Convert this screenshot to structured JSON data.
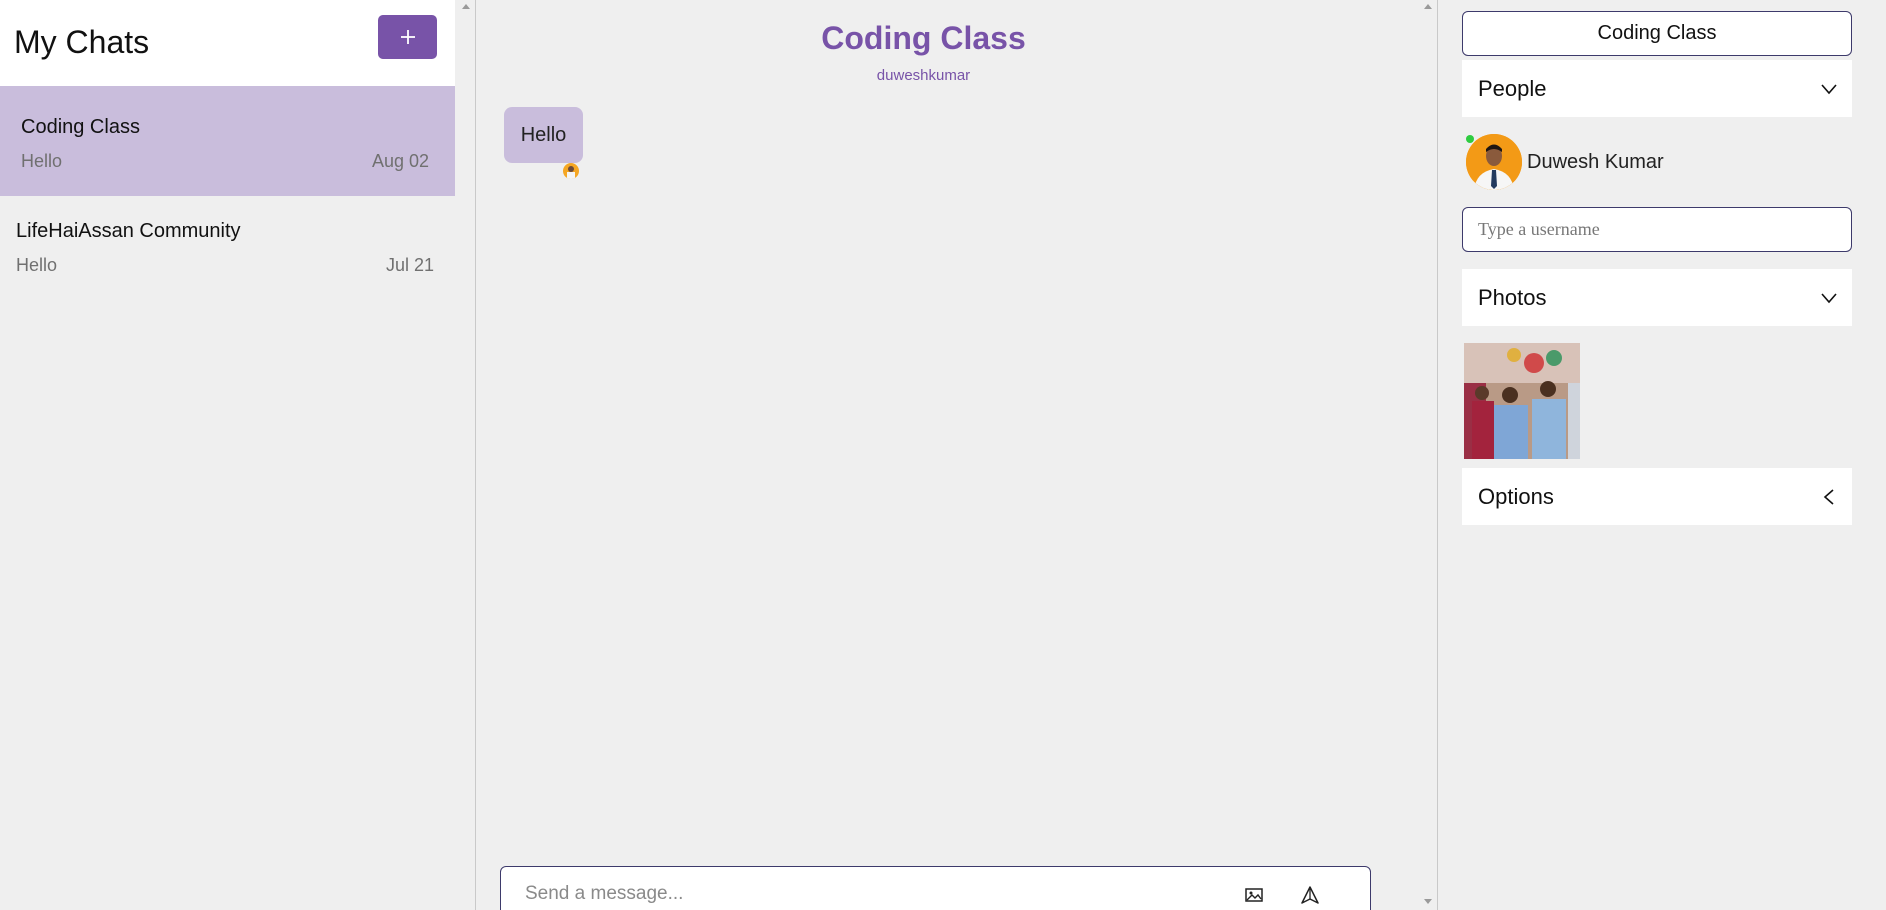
{
  "sidebar": {
    "title": "My Chats",
    "new_chat_icon": "plus-icon",
    "chats": [
      {
        "name": "Coding Class",
        "last_message": "Hello",
        "date": "Aug 02",
        "active": true
      },
      {
        "name": "LifeHaiAssan Community",
        "last_message": "Hello",
        "date": "Jul 21",
        "active": false
      }
    ]
  },
  "chat": {
    "title": "Coding Class",
    "subtitle": "duweshkumar",
    "messages": [
      {
        "text": "Hello"
      }
    ],
    "composer": {
      "placeholder": "Send a message...",
      "image_icon": "image-icon",
      "send_icon": "send-icon"
    }
  },
  "settings": {
    "group_name": "Coding Class",
    "people_label": "People",
    "people": [
      {
        "name": "Duwesh Kumar",
        "online": true
      }
    ],
    "username_placeholder": "Type a username",
    "photos_label": "Photos",
    "options_label": "Options"
  },
  "colors": {
    "accent": "#7853a8",
    "active_chat": "#c9bddc",
    "background": "#efefef",
    "online": "#2ecc40"
  }
}
